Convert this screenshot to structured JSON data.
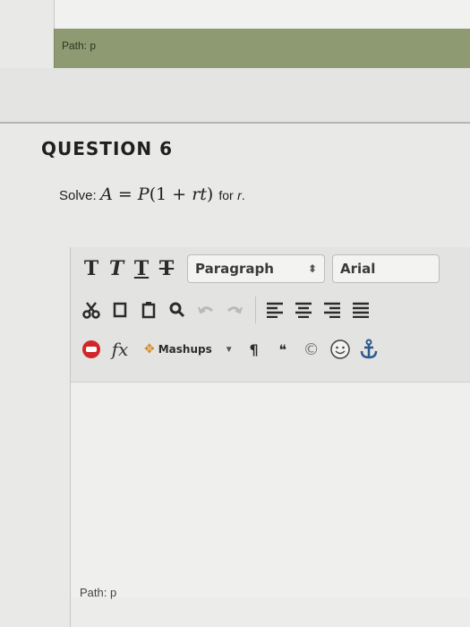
{
  "previous_editor": {
    "path_label": "Path: p"
  },
  "question": {
    "title": "QUESTION 6",
    "lead": "Solve:",
    "equation_lhs": "A",
    "equation_eq": " = ",
    "equation_rhs_p": "P",
    "equation_rhs_rest": "(1 + ",
    "equation_rhs_rt": "rt",
    "equation_close": ")",
    "tail": "for",
    "variable": "r",
    "period": "."
  },
  "toolbar": {
    "row1": {
      "bold": "T",
      "italic": "T",
      "underline": "T",
      "strikethrough": "T",
      "paragraph_select": "Paragraph",
      "font_select": "Arial"
    },
    "row3": {
      "math_label": "fx",
      "mashups_label": "Mashups",
      "pilcrow": "¶",
      "quote": "❝",
      "copyright": "©"
    }
  },
  "editor": {
    "path_label": "Path: p"
  },
  "colors": {
    "path_bar": "#8e9a72",
    "spellcheck_red": "#d2262b",
    "anchor": "#2d5a8c"
  }
}
